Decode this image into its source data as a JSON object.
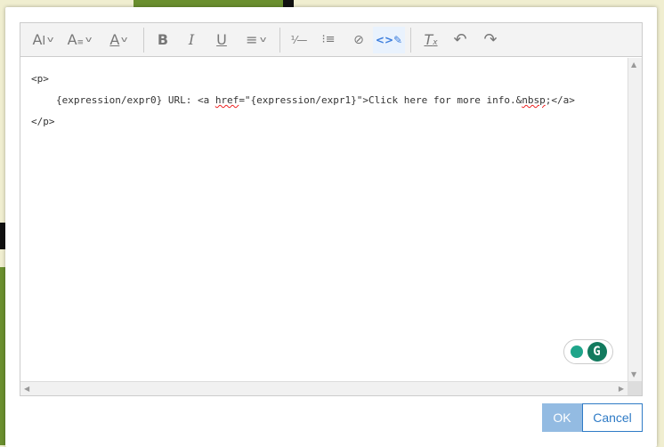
{
  "toolbar": {
    "items": [
      {
        "name": "font-size",
        "glyph": "AI"
      },
      {
        "name": "format",
        "glyph": "A≡"
      },
      {
        "name": "font-color",
        "glyph": "A"
      },
      {
        "name": "bold",
        "glyph": "B"
      },
      {
        "name": "italic",
        "glyph": "I"
      },
      {
        "name": "underline",
        "glyph": "U"
      },
      {
        "name": "align",
        "glyph": "≡"
      },
      {
        "name": "numbered-list",
        "glyph": "⅟≡"
      },
      {
        "name": "bulleted-list",
        "glyph": "⁝≡"
      },
      {
        "name": "link",
        "glyph": "🔗"
      },
      {
        "name": "source-edit",
        "glyph": "<>"
      },
      {
        "name": "remove-format",
        "glyph": "Tx"
      },
      {
        "name": "undo",
        "glyph": "↶"
      },
      {
        "name": "redo",
        "glyph": "↷"
      }
    ]
  },
  "content": {
    "line1": "<p>",
    "line2_a": "{expression/expr0} URL: <a ",
    "line2_b": "href",
    "line2_c": "=\"{expression/expr1}\">Click here for more info.&",
    "line2_d": "nbsp",
    "line2_e": ";</a>",
    "line3": "</p>"
  },
  "grammarly": {
    "logo": "G"
  },
  "buttons": {
    "ok": "OK",
    "cancel": "Cancel"
  }
}
